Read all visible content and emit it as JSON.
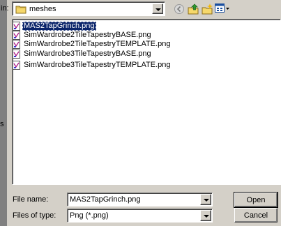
{
  "left_edge": {
    "lookin_fragment": "in:",
    "char_fragment": "s"
  },
  "lookin": {
    "value": "meshes"
  },
  "toolbar": {
    "back_icon": "back-arrow-icon",
    "up_icon": "up-folder-icon",
    "new_folder_icon": "new-folder-icon",
    "views_icon": "views-menu-icon"
  },
  "files": [
    {
      "name": "MAS2TapGrinch.png",
      "selected": true
    },
    {
      "name": "SimWardrobe2TileTapestryBASE.png",
      "selected": false
    },
    {
      "name": "SimWardrobe2TileTapestryTEMPLATE.png",
      "selected": false
    },
    {
      "name": "SimWardrobe3TileTapestryBASE.png",
      "selected": false
    },
    {
      "name": "SimWardrobe3TileTapestryTEMPLATE.png",
      "selected": false
    }
  ],
  "filename": {
    "label": "File name:",
    "value": "MAS2TapGrinch.png"
  },
  "filetype": {
    "label": "Files of type:",
    "value": "Png (*.png)"
  },
  "buttons": {
    "open": "Open",
    "cancel": "Cancel"
  },
  "colors": {
    "selection": "#0a246a",
    "dialog": "#d4d0c8",
    "strip": "#808080"
  }
}
